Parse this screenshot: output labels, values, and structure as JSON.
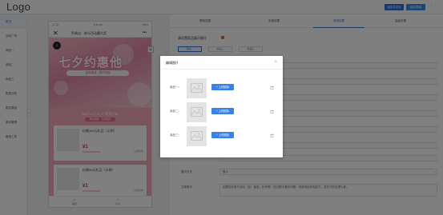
{
  "app": {
    "logo": "Logo",
    "actions": {
      "primary": "保存并发布",
      "secondary": "保存草稿",
      "more": "⋮"
    }
  },
  "sidebar": {
    "items": [
      {
        "label": "首页"
      },
      {
        "label": "活动广场"
      },
      {
        "label": "商品一"
      },
      {
        "label": "商品二"
      },
      {
        "label": "商品三"
      },
      {
        "label": "数据分析"
      },
      {
        "label": "图文模板"
      },
      {
        "label": "素材管理"
      },
      {
        "label": "营销工具"
      }
    ]
  },
  "preview": {
    "status": {
      "signal": "•••• 令",
      "time": "9:41 AM",
      "battery": "100%"
    },
    "title": "乔装自…参与活动赢大奖",
    "banner_headline": "七夕约惠他",
    "banner_sub": "全场满减 · 限时抢购",
    "promo_date": "08月13日 11:07 距离开始",
    "promo_tag": "限时抢购 · 立即预约",
    "products": [
      {
        "name": "价格100元礼品（示例）",
        "price": "¥1",
        "action": "立即抢购"
      },
      {
        "name": "价格50元礼品（示例）",
        "price": "¥1",
        "action": "立即抢购"
      }
    ],
    "tabbar": [
      {
        "label": "首页"
      },
      {
        "label": "我的"
      }
    ]
  },
  "panel": {
    "tabs": [
      {
        "label": "基础设置"
      },
      {
        "label": "页面设置"
      },
      {
        "label": "奖品设置"
      },
      {
        "label": "高级设置"
      }
    ],
    "section_label": "请设置奖品展示图片",
    "chips": [
      {
        "label": "奖品一"
      },
      {
        "label": "奖品二"
      },
      {
        "label": "奖品三"
      }
    ],
    "rows": [
      {
        "label": "展示方式",
        "value": "默认"
      },
      {
        "label": "立即参与",
        "value": "如果您在参与活动（如：抽奖、秒杀等）的过程中遇到问题，请咨询活动发起方，发布方的处理为准。"
      }
    ]
  },
  "modal": {
    "title": "编辑图片",
    "close": "×",
    "rows": [
      {
        "label": "商品一：",
        "upload": "上传图标"
      },
      {
        "label": "商品二：",
        "upload": "上传图标"
      },
      {
        "label": "商品三：",
        "upload": "上传图标"
      }
    ]
  },
  "colors": {
    "accent": "#2f6fd6",
    "upload_button": "#3b82e6",
    "banner_pink": "#e28aa6",
    "price_red": "#e2314e"
  }
}
